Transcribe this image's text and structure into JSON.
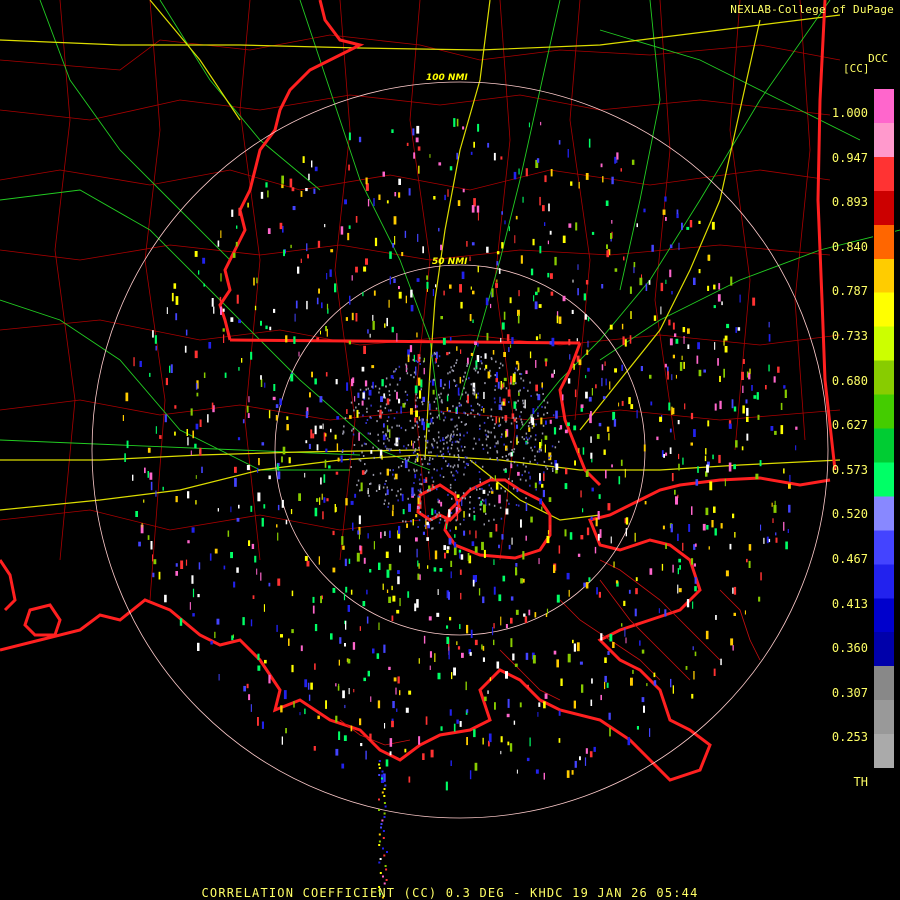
{
  "credit": "NEXLAB-College of DuPage",
  "product_code": "DCC",
  "unit": "[CC]",
  "caption": "CORRELATION COEFFICIENT (CC) 0.3 DEG - KHDC 19 JAN 26 05:44",
  "range_rings": {
    "outer": "100 NMI",
    "inner": "50 NMI"
  },
  "legend": {
    "ticks": [
      "1.000",
      "0.947",
      "0.893",
      "0.840",
      "0.787",
      "0.733",
      "0.680",
      "0.627",
      "0.573",
      "0.520",
      "0.467",
      "0.413",
      "0.360",
      "0.307",
      "0.253",
      "TH"
    ],
    "colors": [
      "#ff66cc",
      "#ff99cc",
      "#ff3333",
      "#cc0000",
      "#ff6600",
      "#ffcc00",
      "#ffff00",
      "#ccff00",
      "#88cc00",
      "#44cc00",
      "#00cc33",
      "#00ff66",
      "#8888ff",
      "#4444ff",
      "#2222ee",
      "#0000cc",
      "#0000aa",
      "#888888",
      "#999999",
      "#aaaaaa",
      "#000000"
    ]
  },
  "colors": {
    "coast": "#ff2020",
    "counties": "#cc0000",
    "roads": "#00ff00",
    "highways": "#ffff00",
    "ring": "#ffcccc",
    "text": "#ffff66"
  }
}
